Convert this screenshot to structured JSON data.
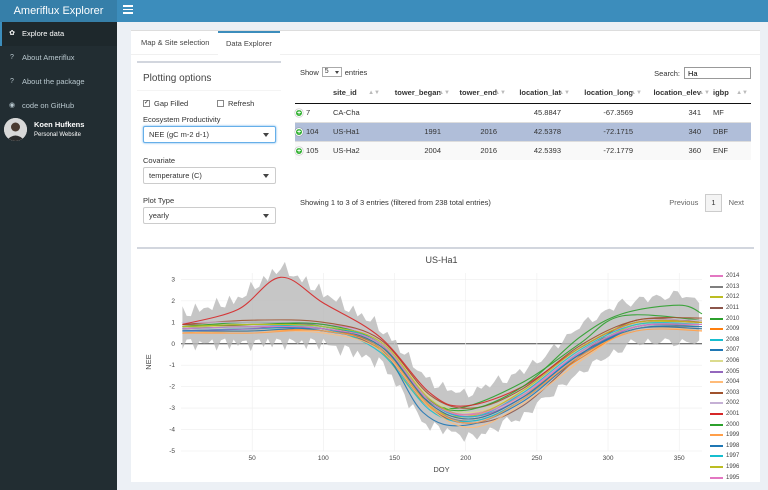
{
  "app": {
    "title": "Ameriflux Explorer"
  },
  "sidebar": {
    "items": [
      {
        "label": "Explore data",
        "icon": "leaf-icon",
        "active": true
      },
      {
        "label": "About Ameriflux",
        "icon": "question-icon",
        "active": false
      },
      {
        "label": "About the package",
        "icon": "question-icon",
        "active": false
      },
      {
        "label": "code on GitHub",
        "icon": "github-icon",
        "active": false
      }
    ],
    "user": {
      "name": "Koen Hufkens",
      "link": "Personal Website"
    }
  },
  "tabs": [
    {
      "label": "Map & Site selection",
      "active": false
    },
    {
      "label": "Data Explorer",
      "active": true
    }
  ],
  "options": {
    "title": "Plotting options",
    "gap_filled": {
      "label": "Gap Filled",
      "checked": true
    },
    "refresh": {
      "label": "Refresh",
      "checked": false
    },
    "productivity": {
      "label": "Ecosystem Productivity",
      "value": "NEE (gC m-2 d-1)"
    },
    "covariate": {
      "label": "Covariate",
      "value": "temperature (C)"
    },
    "plot_type": {
      "label": "Plot Type",
      "value": "yearly"
    }
  },
  "table": {
    "show_label": "Show",
    "length_value": "5",
    "entries_label": "entries",
    "search_label": "Search:",
    "search_value": "Ha",
    "columns": [
      "",
      "site_id",
      "tower_began",
      "tower_end",
      "location_lat",
      "location_long",
      "location_elev",
      "igbp"
    ],
    "rows": [
      {
        "id": "7",
        "site_id": "CA-Cha",
        "tower_began": "",
        "tower_end": "",
        "location_lat": "45.8847",
        "location_long": "-67.3569",
        "location_elev": "341",
        "igbp": "MF",
        "selected": false
      },
      {
        "id": "104",
        "site_id": "US-Ha1",
        "tower_began": "1991",
        "tower_end": "2016",
        "location_lat": "42.5378",
        "location_long": "-72.1715",
        "location_elev": "340",
        "igbp": "DBF",
        "selected": true
      },
      {
        "id": "105",
        "site_id": "US-Ha2",
        "tower_began": "2004",
        "tower_end": "2016",
        "location_lat": "42.5393",
        "location_long": "-72.1779",
        "location_elev": "360",
        "igbp": "ENF",
        "selected": false
      }
    ],
    "info": "Showing 1 to 3 of 3 entries (filtered from 238 total entries)",
    "pager": {
      "previous": "Previous",
      "page": "1",
      "next": "Next"
    }
  },
  "chart_data": {
    "type": "line",
    "title": "US-Ha1",
    "xlabel": "DOY",
    "ylabel": "NEE",
    "xlim": [
      0,
      366
    ],
    "ylim": [
      -5,
      3.3
    ],
    "xticks": [
      50,
      100,
      150,
      200,
      250,
      300,
      350
    ],
    "yticks": [
      3,
      2,
      1,
      0,
      -1,
      -2,
      -3,
      -4,
      -5
    ],
    "legend_position": "right",
    "series": [
      {
        "name": "2014",
        "color": "#e377c2",
        "values": [
          [
            1,
            0.8
          ],
          [
            50,
            0.8
          ],
          [
            100,
            0.9
          ],
          [
            140,
            0.2
          ],
          [
            175,
            -2.6
          ],
          [
            200,
            -3.3
          ],
          [
            240,
            -2.3
          ],
          [
            280,
            -0.4
          ],
          [
            320,
            1.0
          ],
          [
            366,
            1.0
          ]
        ]
      },
      {
        "name": "2013",
        "color": "#7f7f7f",
        "values": [
          [
            1,
            0.6
          ],
          [
            50,
            0.7
          ],
          [
            100,
            0.7
          ],
          [
            140,
            -0.2
          ],
          [
            175,
            -2.9
          ],
          [
            205,
            -3.6
          ],
          [
            240,
            -2.6
          ],
          [
            280,
            -0.6
          ],
          [
            320,
            0.8
          ],
          [
            366,
            0.8
          ]
        ]
      },
      {
        "name": "2012",
        "color": "#bcbd22",
        "values": [
          [
            1,
            0.7
          ],
          [
            50,
            0.9
          ],
          [
            100,
            0.8
          ],
          [
            135,
            0.0
          ],
          [
            170,
            -2.7
          ],
          [
            200,
            -3.4
          ],
          [
            240,
            -2.4
          ],
          [
            280,
            -0.5
          ],
          [
            320,
            0.9
          ],
          [
            366,
            1.0
          ]
        ]
      },
      {
        "name": "2011",
        "color": "#8c564b",
        "values": [
          [
            1,
            0.9
          ],
          [
            50,
            0.8
          ],
          [
            100,
            0.7
          ],
          [
            140,
            -0.3
          ],
          [
            175,
            -3.0
          ],
          [
            205,
            -3.7
          ],
          [
            240,
            -2.9
          ],
          [
            285,
            -0.3
          ],
          [
            320,
            1.1
          ],
          [
            366,
            1.0
          ]
        ]
      },
      {
        "name": "2010",
        "color": "#2ca02c",
        "values": [
          [
            1,
            0.8
          ],
          [
            50,
            1.0
          ],
          [
            100,
            0.8
          ],
          [
            140,
            0.0
          ],
          [
            170,
            -2.4
          ],
          [
            195,
            -3.0
          ],
          [
            240,
            -1.8
          ],
          [
            280,
            0.0
          ],
          [
            310,
            1.3
          ],
          [
            366,
            1.1
          ]
        ]
      },
      {
        "name": "2009",
        "color": "#ff7f0e",
        "values": [
          [
            1,
            0.5
          ],
          [
            50,
            0.6
          ],
          [
            100,
            0.6
          ],
          [
            140,
            -0.1
          ],
          [
            175,
            -2.8
          ],
          [
            205,
            -3.5
          ],
          [
            240,
            -2.5
          ],
          [
            280,
            -0.7
          ],
          [
            320,
            0.7
          ],
          [
            366,
            0.7
          ]
        ]
      },
      {
        "name": "2008",
        "color": "#17becf",
        "values": [
          [
            1,
            0.6
          ],
          [
            50,
            0.7
          ],
          [
            100,
            0.7
          ],
          [
            140,
            -0.4
          ],
          [
            175,
            -3.1
          ],
          [
            205,
            -3.6
          ],
          [
            240,
            -2.6
          ],
          [
            280,
            -0.4
          ],
          [
            320,
            0.8
          ],
          [
            366,
            0.9
          ]
        ]
      },
      {
        "name": "2007",
        "color": "#1f77b4",
        "values": [
          [
            1,
            0.7
          ],
          [
            50,
            0.8
          ],
          [
            100,
            0.6
          ],
          [
            140,
            -0.2
          ],
          [
            170,
            -3.2
          ],
          [
            200,
            -3.8
          ],
          [
            240,
            -2.7
          ],
          [
            280,
            -0.6
          ],
          [
            320,
            0.7
          ],
          [
            366,
            0.8
          ]
        ]
      },
      {
        "name": "2006",
        "color": "#dbdb8d",
        "values": [
          [
            1,
            0.8
          ],
          [
            50,
            0.8
          ],
          [
            100,
            0.8
          ],
          [
            140,
            0.1
          ],
          [
            175,
            -2.5
          ],
          [
            205,
            -3.2
          ],
          [
            240,
            -2.2
          ],
          [
            280,
            -0.3
          ],
          [
            320,
            0.9
          ],
          [
            366,
            0.9
          ]
        ]
      },
      {
        "name": "2005",
        "color": "#9467bd",
        "values": [
          [
            1,
            0.6
          ],
          [
            50,
            0.7
          ],
          [
            100,
            0.9
          ],
          [
            140,
            0.0
          ],
          [
            175,
            -2.7
          ],
          [
            205,
            -3.4
          ],
          [
            240,
            -2.5
          ],
          [
            280,
            -0.5
          ],
          [
            320,
            0.8
          ],
          [
            366,
            0.9
          ]
        ]
      },
      {
        "name": "2004",
        "color": "#ffbb78",
        "values": [
          [
            1,
            0.5
          ],
          [
            50,
            0.6
          ],
          [
            100,
            0.5
          ],
          [
            140,
            -0.3
          ],
          [
            175,
            -3.0
          ],
          [
            205,
            -3.9
          ],
          [
            240,
            -2.8
          ],
          [
            285,
            -0.6
          ],
          [
            320,
            0.7
          ],
          [
            366,
            0.6
          ]
        ]
      },
      {
        "name": "2003",
        "color": "#a0522d",
        "values": [
          [
            1,
            0.9
          ],
          [
            50,
            1.1
          ],
          [
            100,
            1.0
          ],
          [
            140,
            0.2
          ],
          [
            175,
            -2.4
          ],
          [
            205,
            -3.0
          ],
          [
            240,
            -2.1
          ],
          [
            280,
            -0.1
          ],
          [
            320,
            1.1
          ],
          [
            366,
            1.2
          ]
        ]
      },
      {
        "name": "2002",
        "color": "#c5b0d5",
        "values": [
          [
            1,
            1.0
          ],
          [
            50,
            1.0
          ],
          [
            100,
            0.9
          ],
          [
            140,
            0.1
          ],
          [
            175,
            -2.6
          ],
          [
            205,
            -3.3
          ],
          [
            240,
            -2.3
          ],
          [
            280,
            -0.2
          ],
          [
            320,
            1.0
          ],
          [
            366,
            1.1
          ]
        ]
      },
      {
        "name": "2001",
        "color": "#d62728",
        "values": [
          [
            1,
            0.9
          ],
          [
            40,
            1.6
          ],
          [
            70,
            3.1
          ],
          [
            100,
            1.9
          ],
          [
            140,
            0.3
          ],
          [
            175,
            -2.3
          ],
          [
            200,
            -2.9
          ],
          [
            240,
            -2.0
          ],
          [
            280,
            -0.2
          ],
          [
            320,
            1.0
          ],
          [
            366,
            1.0
          ]
        ]
      },
      {
        "name": "2000",
        "color": "#2ca02c",
        "values": [
          [
            1,
            0.8
          ],
          [
            50,
            0.9
          ],
          [
            100,
            0.9
          ],
          [
            140,
            0.0
          ],
          [
            170,
            -2.5
          ],
          [
            200,
            -3.1
          ],
          [
            240,
            -2.0
          ],
          [
            280,
            0.3
          ],
          [
            310,
            1.4
          ],
          [
            350,
            1.8
          ],
          [
            366,
            1.4
          ]
        ]
      },
      {
        "name": "1999",
        "color": "#ff9f4a",
        "values": [
          [
            1,
            0.5
          ],
          [
            50,
            0.5
          ],
          [
            100,
            0.6
          ],
          [
            140,
            -0.2
          ],
          [
            175,
            -2.9
          ],
          [
            205,
            -3.7
          ],
          [
            240,
            -2.6
          ],
          [
            280,
            -0.6
          ],
          [
            320,
            0.6
          ],
          [
            366,
            0.6
          ]
        ]
      },
      {
        "name": "1998",
        "color": "#1f77b4",
        "values": [
          [
            1,
            0.6
          ],
          [
            50,
            0.6
          ],
          [
            100,
            0.7
          ],
          [
            140,
            -0.1
          ],
          [
            175,
            -2.8
          ],
          [
            205,
            -3.5
          ],
          [
            240,
            -2.5
          ],
          [
            280,
            -0.5
          ],
          [
            320,
            0.7
          ],
          [
            366,
            0.7
          ]
        ]
      },
      {
        "name": "1997",
        "color": "#17becf",
        "values": [
          [
            1,
            0.7
          ],
          [
            50,
            0.8
          ],
          [
            100,
            0.8
          ],
          [
            140,
            0.0
          ],
          [
            175,
            -2.7
          ],
          [
            205,
            -3.4
          ],
          [
            240,
            -2.3
          ],
          [
            280,
            -0.3
          ],
          [
            320,
            0.9
          ],
          [
            366,
            0.9
          ]
        ]
      },
      {
        "name": "1996",
        "color": "#bcbd22",
        "values": [
          [
            1,
            0.8
          ],
          [
            50,
            0.9
          ],
          [
            100,
            0.8
          ],
          [
            140,
            0.1
          ],
          [
            175,
            -2.6
          ],
          [
            205,
            -3.3
          ],
          [
            240,
            -2.2
          ],
          [
            280,
            -0.2
          ],
          [
            320,
            1.0
          ],
          [
            366,
            1.0
          ]
        ]
      },
      {
        "name": "1995",
        "color": "#e377c2",
        "values": [
          [
            1,
            0.7
          ],
          [
            50,
            0.8
          ],
          [
            100,
            0.7
          ],
          [
            140,
            0.0
          ],
          [
            175,
            -2.7
          ],
          [
            205,
            -3.3
          ],
          [
            240,
            -2.4
          ],
          [
            280,
            -0.4
          ],
          [
            320,
            0.8
          ],
          [
            366,
            0.9
          ]
        ]
      }
    ]
  }
}
